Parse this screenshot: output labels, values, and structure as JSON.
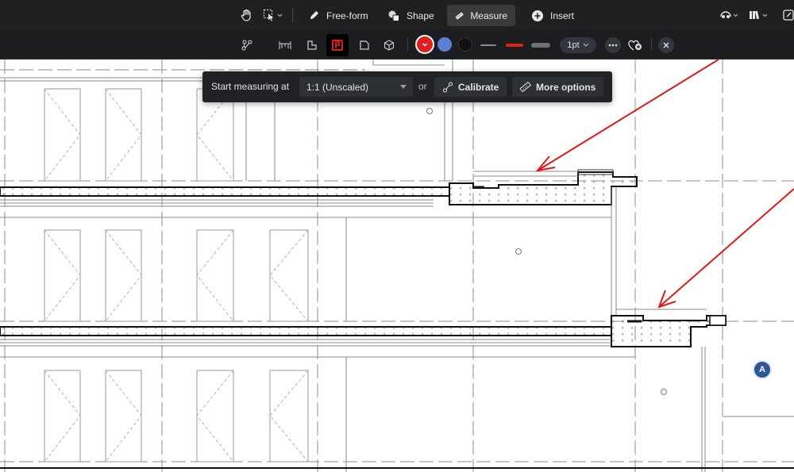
{
  "toolbar": {
    "tools": [
      {
        "label": "Free-form"
      },
      {
        "label": "Shape"
      },
      {
        "label": "Measure"
      },
      {
        "label": "Insert"
      }
    ]
  },
  "measure_bar": {
    "line_weight": "1pt",
    "colors": {
      "selected": "#e02020",
      "blue": "#5b7fd4",
      "black": "#111111",
      "stroke_gray": "#8a8a8a",
      "stroke_red": "#e02020",
      "stroke_light": "#6f6f6f"
    }
  },
  "measure_popover": {
    "start_label": "Start measuring at",
    "scale_value": "1:1 (Unscaled)",
    "or_label": "or",
    "calibrate_label": "Calibrate",
    "more_options_label": "More options"
  },
  "drawing": {
    "markup_badge": "A",
    "annotation_color": "#e01818"
  }
}
